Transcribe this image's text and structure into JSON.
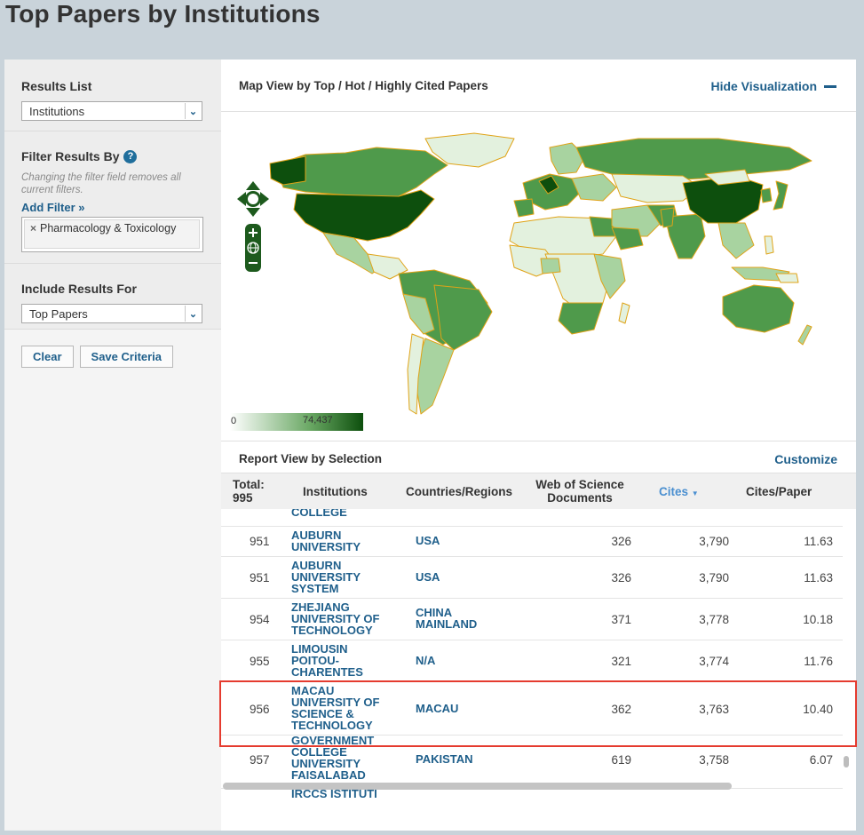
{
  "page_title": "Top Papers by Institutions",
  "sidebar": {
    "results_list_heading": "Results List",
    "results_list_value": "Institutions",
    "filter_heading": "Filter Results By",
    "filter_note": "Changing the filter field removes all current filters.",
    "add_filter": "Add Filter »",
    "filter_chip": "Pharmacology & Toxicology",
    "include_heading": "Include Results For",
    "include_value": "Top Papers",
    "clear_label": "Clear",
    "save_label": "Save Criteria"
  },
  "map": {
    "title": "Map View by Top / Hot / Highly Cited Papers",
    "hide_label": "Hide Visualization",
    "legend_min": "0",
    "legend_max": "74,437",
    "colors": {
      "dark": "#0d4f0d",
      "mid": "#4f9a4b",
      "light": "#a8d3a0",
      "pale": "#e3f1de",
      "border": "#e0a317"
    }
  },
  "report": {
    "title": "Report View by Selection",
    "customize_label": "Customize",
    "headers": {
      "total_label": "Total:",
      "total_value": "995",
      "institutions": "Institutions",
      "countries": "Countries/Regions",
      "docs": "Web of Science Documents",
      "cites": "Cites",
      "cpp": "Cites/Paper"
    },
    "partial_top": "COLLEGE",
    "rows": [
      {
        "rank": "951",
        "name": "AUBURN UNIVERSITY",
        "country": "USA",
        "docs": "326",
        "cites": "3,790",
        "cpp": "11.63"
      },
      {
        "rank": "951",
        "name": "AUBURN UNIVERSITY SYSTEM",
        "country": "USA",
        "docs": "326",
        "cites": "3,790",
        "cpp": "11.63"
      },
      {
        "rank": "954",
        "name": "ZHEJIANG UNIVERSITY OF TECHNOLOGY",
        "country": "CHINA MAINLAND",
        "docs": "371",
        "cites": "3,778",
        "cpp": "10.18"
      },
      {
        "rank": "955",
        "name": "LIMOUSIN POITOU-CHARENTES",
        "country": "N/A",
        "docs": "321",
        "cites": "3,774",
        "cpp": "11.76"
      },
      {
        "rank": "956",
        "name": "MACAU UNIVERSITY OF SCIENCE & TECHNOLOGY",
        "country": "MACAU",
        "docs": "362",
        "cites": "3,763",
        "cpp": "10.40"
      },
      {
        "rank": "957",
        "name": "GOVERNMENT COLLEGE UNIVERSITY FAISALABAD",
        "country": "PAKISTAN",
        "docs": "619",
        "cites": "3,758",
        "cpp": "6.07"
      },
      {
        "rank": "",
        "name": "IRCCS ISTITUTI FISIOTERAPICI",
        "country": "",
        "docs": "",
        "cites": "",
        "cpp": ""
      }
    ]
  }
}
